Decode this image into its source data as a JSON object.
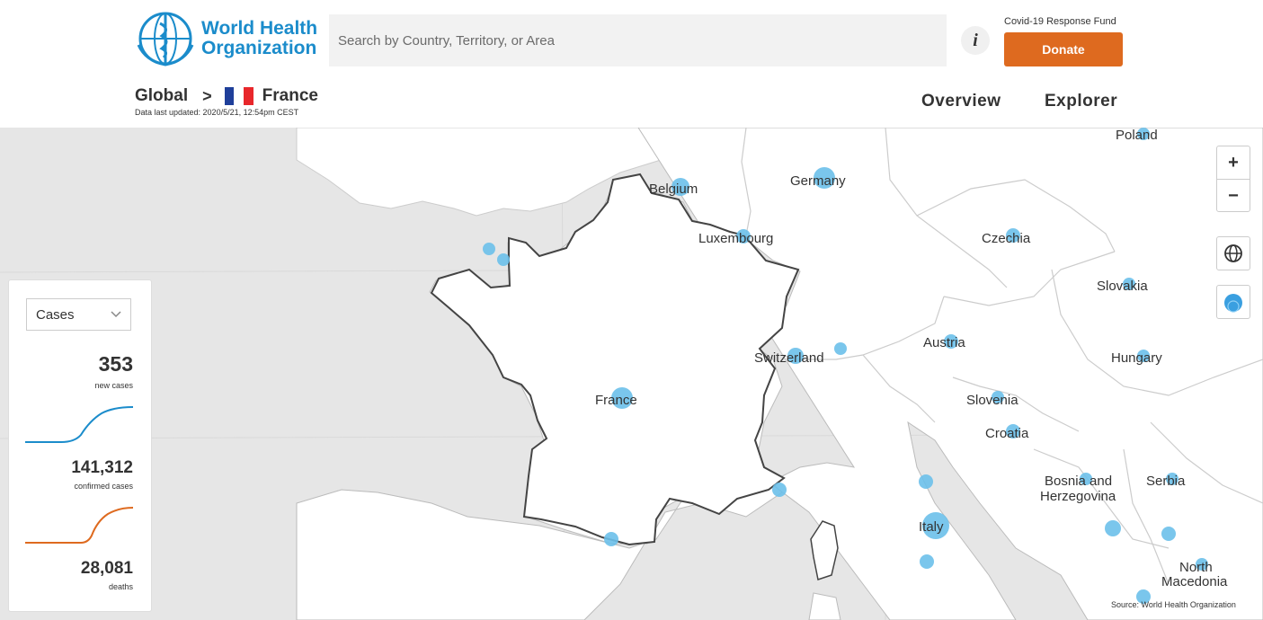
{
  "header": {
    "logo_text_line1": "World Health",
    "logo_text_line2": "Organization",
    "search_placeholder": "Search by Country, Territory, or Area",
    "info_icon": "i",
    "fund_label": "Covid-19 Response Fund",
    "donate_label": "Donate",
    "nav": {
      "overview": "Overview",
      "explorer": "Explorer"
    }
  },
  "breadcrumb": {
    "global": "Global",
    "separator": ">",
    "country": "France",
    "updated": "Data last updated: 2020/5/21, 12:54pm CEST"
  },
  "panel": {
    "select_value": "Cases",
    "new_cases": "353",
    "new_cases_label": "new cases",
    "confirmed": "141,312",
    "confirmed_label": "confirmed cases",
    "deaths": "28,081",
    "deaths_label": "deaths",
    "colors": {
      "cases_line": "#1b8ccb",
      "deaths_line": "#de6a1f"
    }
  },
  "map": {
    "countries": [
      "Poland",
      "Germany",
      "Belgium",
      "Luxembourg",
      "Czechia",
      "Slovakia",
      "Austria",
      "Switzerland",
      "Hungary",
      "France",
      "Slovenia",
      "Croatia",
      "Bosnia and",
      "Herzegovina",
      "Serbia",
      "Italy",
      "North",
      "Macedonia"
    ],
    "zoom_in": "+",
    "zoom_out": "−",
    "source": "Source: World Health Organization",
    "colors": {
      "land": "#ffffff",
      "sea": "#e6e6e6",
      "bubble": "#6cc0ea",
      "border": "#333333"
    }
  },
  "colors": {
    "brand": "#1b8ccb",
    "accent": "#de6a1f"
  }
}
